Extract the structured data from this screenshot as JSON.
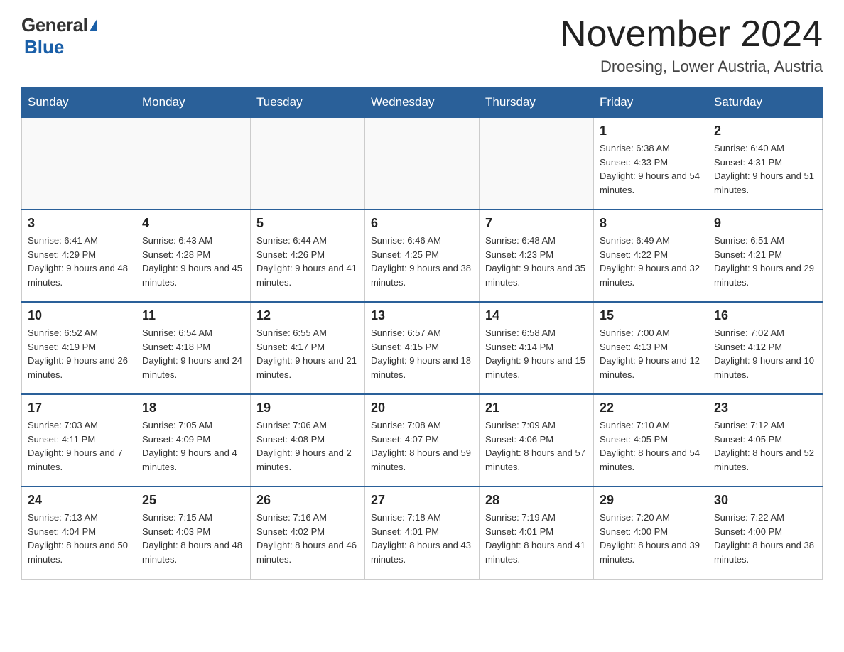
{
  "logo": {
    "general": "General",
    "blue": "Blue",
    "triangle": "▶"
  },
  "title": "November 2024",
  "location": "Droesing, Lower Austria, Austria",
  "days_of_week": [
    "Sunday",
    "Monday",
    "Tuesday",
    "Wednesday",
    "Thursday",
    "Friday",
    "Saturday"
  ],
  "weeks": [
    [
      {
        "day": "",
        "info": ""
      },
      {
        "day": "",
        "info": ""
      },
      {
        "day": "",
        "info": ""
      },
      {
        "day": "",
        "info": ""
      },
      {
        "day": "",
        "info": ""
      },
      {
        "day": "1",
        "info": "Sunrise: 6:38 AM\nSunset: 4:33 PM\nDaylight: 9 hours and 54 minutes."
      },
      {
        "day": "2",
        "info": "Sunrise: 6:40 AM\nSunset: 4:31 PM\nDaylight: 9 hours and 51 minutes."
      }
    ],
    [
      {
        "day": "3",
        "info": "Sunrise: 6:41 AM\nSunset: 4:29 PM\nDaylight: 9 hours and 48 minutes."
      },
      {
        "day": "4",
        "info": "Sunrise: 6:43 AM\nSunset: 4:28 PM\nDaylight: 9 hours and 45 minutes."
      },
      {
        "day": "5",
        "info": "Sunrise: 6:44 AM\nSunset: 4:26 PM\nDaylight: 9 hours and 41 minutes."
      },
      {
        "day": "6",
        "info": "Sunrise: 6:46 AM\nSunset: 4:25 PM\nDaylight: 9 hours and 38 minutes."
      },
      {
        "day": "7",
        "info": "Sunrise: 6:48 AM\nSunset: 4:23 PM\nDaylight: 9 hours and 35 minutes."
      },
      {
        "day": "8",
        "info": "Sunrise: 6:49 AM\nSunset: 4:22 PM\nDaylight: 9 hours and 32 minutes."
      },
      {
        "day": "9",
        "info": "Sunrise: 6:51 AM\nSunset: 4:21 PM\nDaylight: 9 hours and 29 minutes."
      }
    ],
    [
      {
        "day": "10",
        "info": "Sunrise: 6:52 AM\nSunset: 4:19 PM\nDaylight: 9 hours and 26 minutes."
      },
      {
        "day": "11",
        "info": "Sunrise: 6:54 AM\nSunset: 4:18 PM\nDaylight: 9 hours and 24 minutes."
      },
      {
        "day": "12",
        "info": "Sunrise: 6:55 AM\nSunset: 4:17 PM\nDaylight: 9 hours and 21 minutes."
      },
      {
        "day": "13",
        "info": "Sunrise: 6:57 AM\nSunset: 4:15 PM\nDaylight: 9 hours and 18 minutes."
      },
      {
        "day": "14",
        "info": "Sunrise: 6:58 AM\nSunset: 4:14 PM\nDaylight: 9 hours and 15 minutes."
      },
      {
        "day": "15",
        "info": "Sunrise: 7:00 AM\nSunset: 4:13 PM\nDaylight: 9 hours and 12 minutes."
      },
      {
        "day": "16",
        "info": "Sunrise: 7:02 AM\nSunset: 4:12 PM\nDaylight: 9 hours and 10 minutes."
      }
    ],
    [
      {
        "day": "17",
        "info": "Sunrise: 7:03 AM\nSunset: 4:11 PM\nDaylight: 9 hours and 7 minutes."
      },
      {
        "day": "18",
        "info": "Sunrise: 7:05 AM\nSunset: 4:09 PM\nDaylight: 9 hours and 4 minutes."
      },
      {
        "day": "19",
        "info": "Sunrise: 7:06 AM\nSunset: 4:08 PM\nDaylight: 9 hours and 2 minutes."
      },
      {
        "day": "20",
        "info": "Sunrise: 7:08 AM\nSunset: 4:07 PM\nDaylight: 8 hours and 59 minutes."
      },
      {
        "day": "21",
        "info": "Sunrise: 7:09 AM\nSunset: 4:06 PM\nDaylight: 8 hours and 57 minutes."
      },
      {
        "day": "22",
        "info": "Sunrise: 7:10 AM\nSunset: 4:05 PM\nDaylight: 8 hours and 54 minutes."
      },
      {
        "day": "23",
        "info": "Sunrise: 7:12 AM\nSunset: 4:05 PM\nDaylight: 8 hours and 52 minutes."
      }
    ],
    [
      {
        "day": "24",
        "info": "Sunrise: 7:13 AM\nSunset: 4:04 PM\nDaylight: 8 hours and 50 minutes."
      },
      {
        "day": "25",
        "info": "Sunrise: 7:15 AM\nSunset: 4:03 PM\nDaylight: 8 hours and 48 minutes."
      },
      {
        "day": "26",
        "info": "Sunrise: 7:16 AM\nSunset: 4:02 PM\nDaylight: 8 hours and 46 minutes."
      },
      {
        "day": "27",
        "info": "Sunrise: 7:18 AM\nSunset: 4:01 PM\nDaylight: 8 hours and 43 minutes."
      },
      {
        "day": "28",
        "info": "Sunrise: 7:19 AM\nSunset: 4:01 PM\nDaylight: 8 hours and 41 minutes."
      },
      {
        "day": "29",
        "info": "Sunrise: 7:20 AM\nSunset: 4:00 PM\nDaylight: 8 hours and 39 minutes."
      },
      {
        "day": "30",
        "info": "Sunrise: 7:22 AM\nSunset: 4:00 PM\nDaylight: 8 hours and 38 minutes."
      }
    ]
  ]
}
